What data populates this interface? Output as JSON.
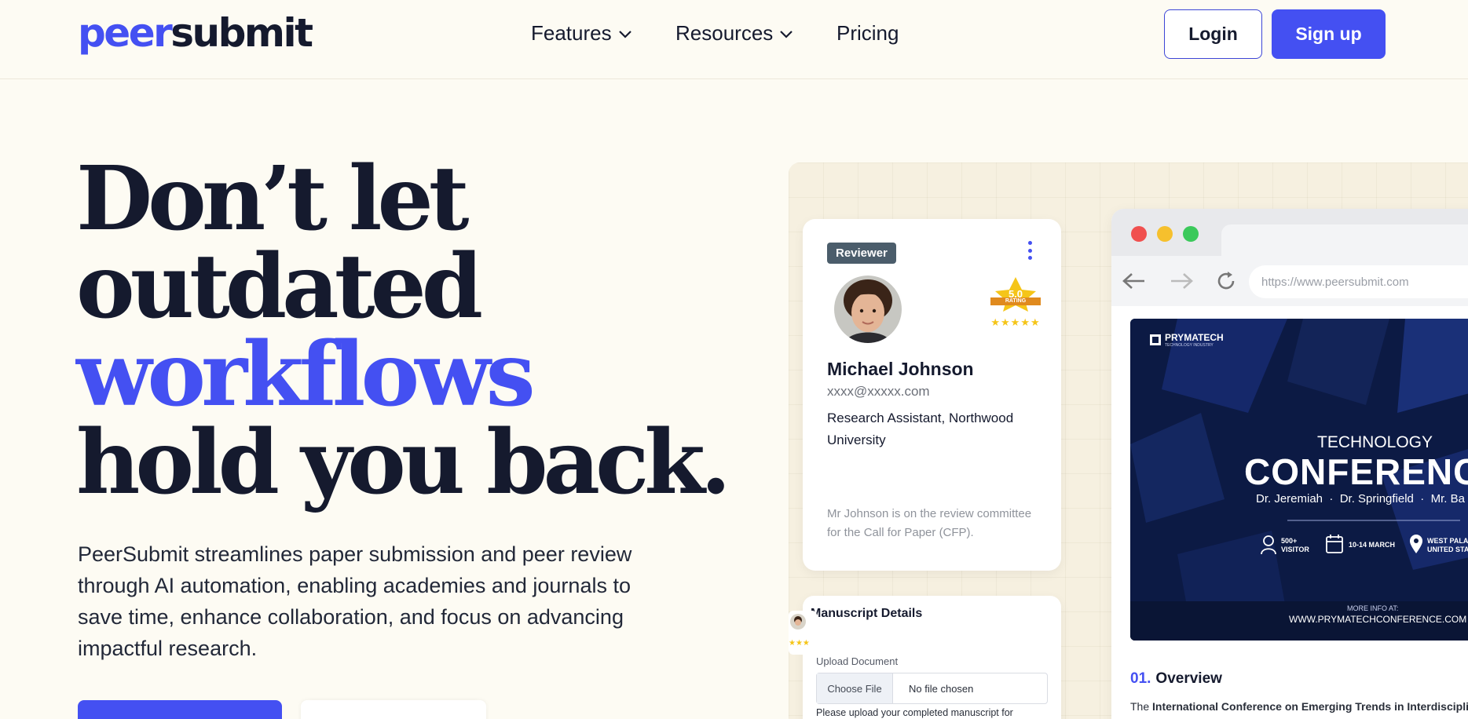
{
  "nav": {
    "logo_part1": "peer",
    "logo_part2": "submit",
    "features": "Features",
    "resources": "Resources",
    "pricing": "Pricing",
    "login": "Login",
    "signup": "Sign up"
  },
  "hero": {
    "line1": "Don’t let",
    "line2": "outdated",
    "line3": "workflows",
    "line4": "hold you back.",
    "lede": "PeerSubmit streamlines paper submission and peer review through AI automation, enabling academies and journals to save time, enhance collaboration, and focus on advancing impactful research."
  },
  "reviewer": {
    "badge": "Reviewer",
    "rating_value": "5.0",
    "rating_label": "RATING",
    "stars": 5,
    "name": "Michael Johnson",
    "email": "xxxx@xxxxx.com",
    "role": "Research Assistant, Northwood University",
    "note": "Mr Johnson is on the review committee for the Call for Paper (CFP)."
  },
  "manuscript": {
    "title": "Manuscript Details",
    "upload_label": "Upload Document",
    "choose_file": "Choose File",
    "no_file": "No file chosen",
    "help": "Please upload your completed manuscript for"
  },
  "browser": {
    "url": "https://www.peersubmit.com",
    "poster": {
      "brand": "PRYMATECH",
      "brand_sub": "TECHNOLOGY INDUSTRY",
      "tech": "TECHNOLOGY",
      "conference": "CONFERENC",
      "speakers": "Dr. Jeremiah  ·  Dr. Springfield  ·  Mr. Ba",
      "visitor_num": "500+",
      "visitor_label": "VISITOR",
      "date": "10-14 MARCH",
      "location1": "WEST PALA",
      "location2": "UNITED STA",
      "more_info": "MORE INFO AT:",
      "website": "WWW.PRYMATECHCONFERENCE.COM"
    },
    "overview_num": "01.",
    "overview_title": "Overview",
    "overview_prefix": "The ",
    "overview_bold": "International Conference on Emerging Trends in Interdisciplin"
  },
  "colors": {
    "brand": "#4450f2",
    "ink": "#151a2e",
    "background": "#fdfbf3"
  }
}
